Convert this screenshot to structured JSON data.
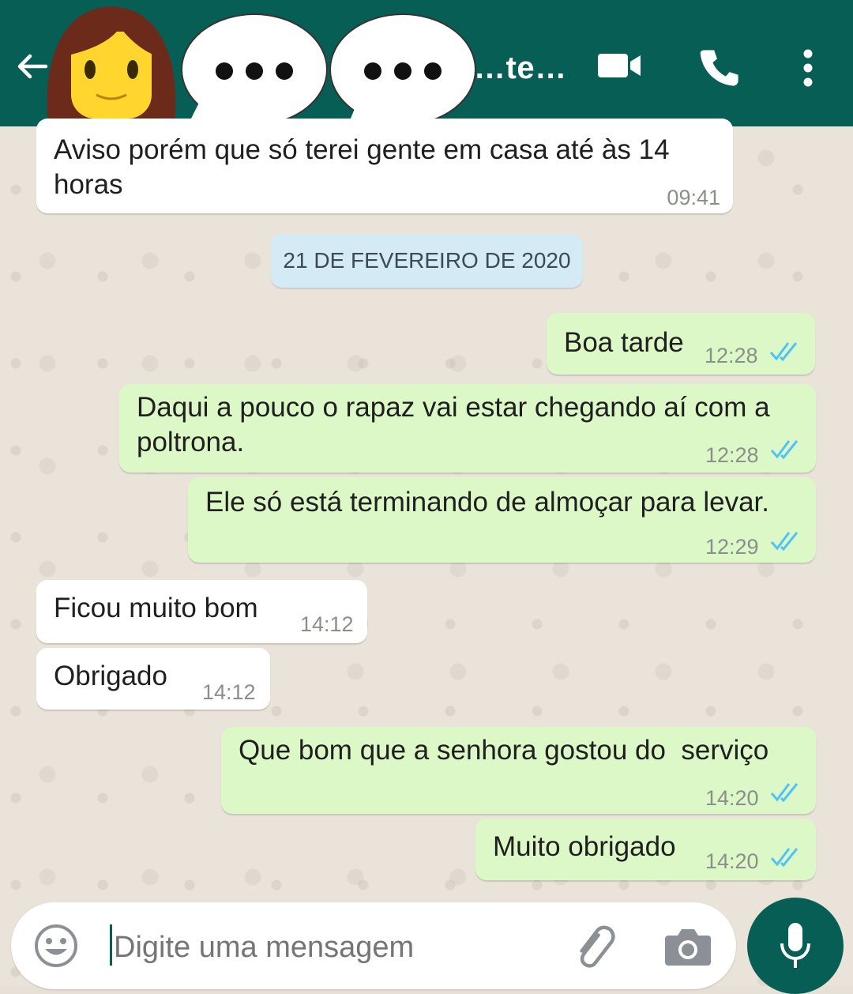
{
  "header": {
    "title": "…te…",
    "censor_bubble_text": "•••"
  },
  "input": {
    "placeholder": "Digite uma mensagem"
  },
  "date_separator": "21 DE FEVEREIRO DE 2020",
  "messages": [
    {
      "text": "Aviso porém que só terei gente em casa até às 14 horas",
      "time": "09:41",
      "direction": "in"
    },
    {
      "text": "Boa tarde",
      "time": "12:28",
      "direction": "out",
      "status": "read"
    },
    {
      "text": "Daqui a pouco o rapaz vai estar chegando aí com a poltrona.",
      "time": "12:28",
      "direction": "out",
      "status": "read"
    },
    {
      "text": "Ele só está terminando de almoçar para levar.",
      "time": "12:29",
      "direction": "out",
      "status": "read"
    },
    {
      "text": "Ficou muito bom",
      "time": "14:12",
      "direction": "in"
    },
    {
      "text": "Obrigado",
      "time": "14:12",
      "direction": "in"
    },
    {
      "text": "Que bom que a senhora gostou do  serviço",
      "time": "14:20",
      "direction": "out",
      "status": "read"
    },
    {
      "text": "Muito obrigado",
      "time": "14:20",
      "direction": "out",
      "status": "read"
    }
  ],
  "colors": {
    "header": "#075e54",
    "outgoing_bubble": "#dcf8c6",
    "incoming_bubble": "#ffffff",
    "read_ticks": "#4fc3f7"
  },
  "icons": [
    "back-arrow-icon",
    "video-call-icon",
    "phone-icon",
    "more-options-icon",
    "emoji-icon",
    "attach-icon",
    "camera-icon",
    "mic-icon"
  ]
}
